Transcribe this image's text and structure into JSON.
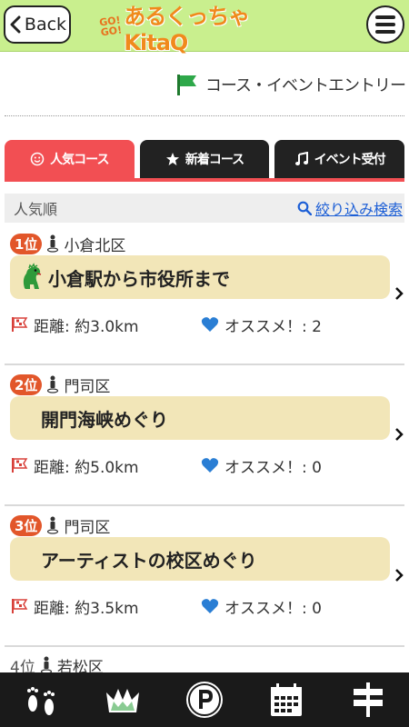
{
  "header": {
    "back_label": "Back",
    "logo_go_top": "GO!",
    "logo_go_bottom": "GO!",
    "logo_text": "あるくっちゃKitaQ"
  },
  "entry": {
    "label": "コース・イベントエントリー"
  },
  "tabs": [
    {
      "label": "人気コース",
      "icon": "smile-icon",
      "active": true
    },
    {
      "label": "新着コース",
      "icon": "star-icon",
      "active": false
    },
    {
      "label": "イベント受付",
      "icon": "music-note-icon",
      "active": false
    }
  ],
  "sort": {
    "label": "人気順",
    "filter_label": "絞り込み検索"
  },
  "courses": [
    {
      "rank": "1位",
      "area": "小倉北区",
      "title": "小倉駅から市役所まで",
      "distance": "距離: 約3.0km",
      "recommend": "オススメ！: 2"
    },
    {
      "rank": "2位",
      "area": "門司区",
      "title": "開門海峡めぐり",
      "distance": "距離: 約5.0km",
      "recommend": "オススメ！: 0"
    },
    {
      "rank": "3位",
      "area": "門司区",
      "title": "アーティストの校区めぐり",
      "distance": "距離: 約3.5km",
      "recommend": "オススメ！: 0"
    },
    {
      "rank": "4位",
      "area": "若松区"
    }
  ],
  "colors": {
    "header_bg": "#c9ef8e",
    "active_tab": "#f24f53",
    "rank_badge": "#e2562a",
    "title_box": "#f2e6b8",
    "link": "#1d5fd6",
    "tabbar_bg": "#1a1a1a"
  },
  "bottom_nav": [
    {
      "icon": "footprints-icon"
    },
    {
      "icon": "crown-icon"
    },
    {
      "icon": "parking-icon"
    },
    {
      "icon": "calendar-icon"
    },
    {
      "icon": "signpost-icon"
    }
  ]
}
